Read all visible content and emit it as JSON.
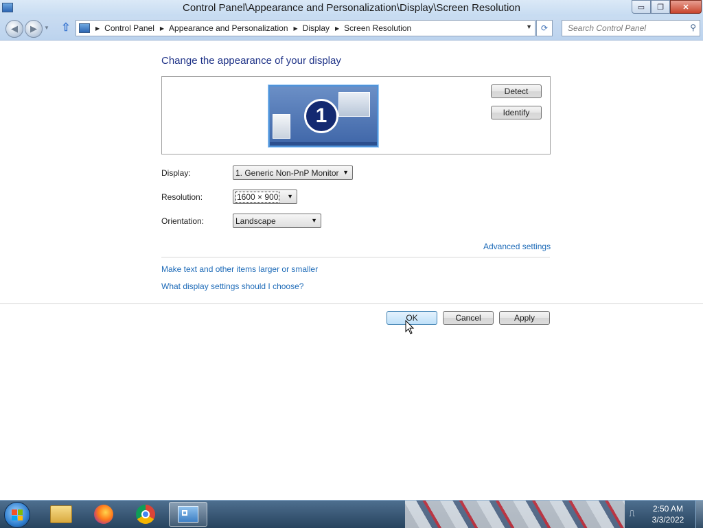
{
  "window": {
    "title": "Control Panel\\Appearance and Personalization\\Display\\Screen Resolution",
    "controls": {
      "minimize": "▭",
      "restore": "❐",
      "close": "✕"
    }
  },
  "nav": {
    "breadcrumbs": [
      "Control Panel",
      "Appearance and Personalization",
      "Display",
      "Screen Resolution"
    ],
    "search_placeholder": "Search Control Panel"
  },
  "main": {
    "heading": "Change the appearance of your display",
    "preview": {
      "monitor_number": "1"
    },
    "detect_label": "Detect",
    "identify_label": "Identify",
    "display": {
      "label": "Display:",
      "value": "1. Generic Non-PnP Monitor"
    },
    "resolution": {
      "label": "Resolution:",
      "value": "1600 × 900"
    },
    "orientation": {
      "label": "Orientation:",
      "value": "Landscape"
    },
    "advanced_link": "Advanced settings",
    "links": [
      "Make text and other items larger or smaller",
      "What display settings should I choose?"
    ]
  },
  "buttons": {
    "ok": "OK",
    "cancel": "Cancel",
    "apply": "Apply"
  },
  "taskbar": {
    "items": [
      "start-button",
      "windows-explorer",
      "firefox",
      "chrome",
      "control-panel"
    ],
    "active_item": "control-panel",
    "clock_time": "2:50 AM",
    "clock_date": "3/3/2022"
  },
  "colors": {
    "heading": "#1e3287",
    "link": "#1e6bb8",
    "title_bar": "#c6dbf1",
    "taskbar": "#27435e"
  }
}
